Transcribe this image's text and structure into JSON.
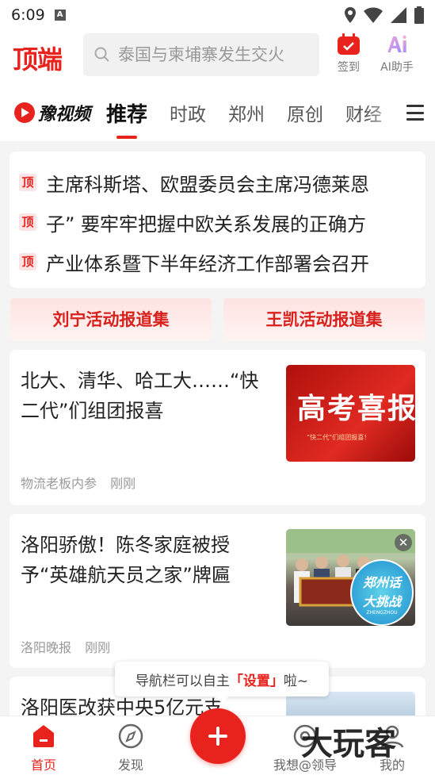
{
  "status_bar": {
    "time": "6:09",
    "notification_badge": "A"
  },
  "header": {
    "logo": "顶端",
    "search_placeholder": "泰国与柬埔寨发生交火",
    "checkin_label": "签到",
    "ai_label": "AI助手"
  },
  "tabs": {
    "brand": "豫视频",
    "items": [
      "推荐",
      "时政",
      "郑州",
      "原创",
      "财经"
    ],
    "active_index": 0
  },
  "headlines": {
    "tag": "顶",
    "items": [
      "主席科斯塔、欧盟委员会主席冯德莱恩",
      "子” 要牢牢把握中欧关系发展的正确方",
      "产业体系暨下半年经济工作部署会召开"
    ]
  },
  "topics": [
    "刘宁活动报道集",
    "王凯活动报道集"
  ],
  "news": [
    {
      "title": "北大、清华、哈工大……“快二代”们组团报喜",
      "source": "物流老板内参",
      "time": "刚刚",
      "thumb_text": "高考喜报",
      "thumb_sub": "“快二代”们组团报喜！"
    },
    {
      "title": "洛阳骄傲！陈冬家庭被授予“英雄航天员之家”牌匾",
      "source": "洛阳晚报",
      "time": "刚刚",
      "badge_line1": "郑州话",
      "badge_line2": "大挑战",
      "badge_sub": "ZHENGZHOU"
    },
    {
      "title": "洛阳医改获中央5亿元支"
    }
  ],
  "tooltip": {
    "prefix": "导航栏可以自主",
    "highlight": "「设置」",
    "suffix": "啦~"
  },
  "bottom_nav": {
    "items": [
      "首页",
      "发现",
      "我想@领导",
      "我的"
    ],
    "active_index": 0
  },
  "watermark": "大玩客",
  "colors": {
    "brand_red": "#e8231e",
    "background": "#f4f4f4"
  }
}
